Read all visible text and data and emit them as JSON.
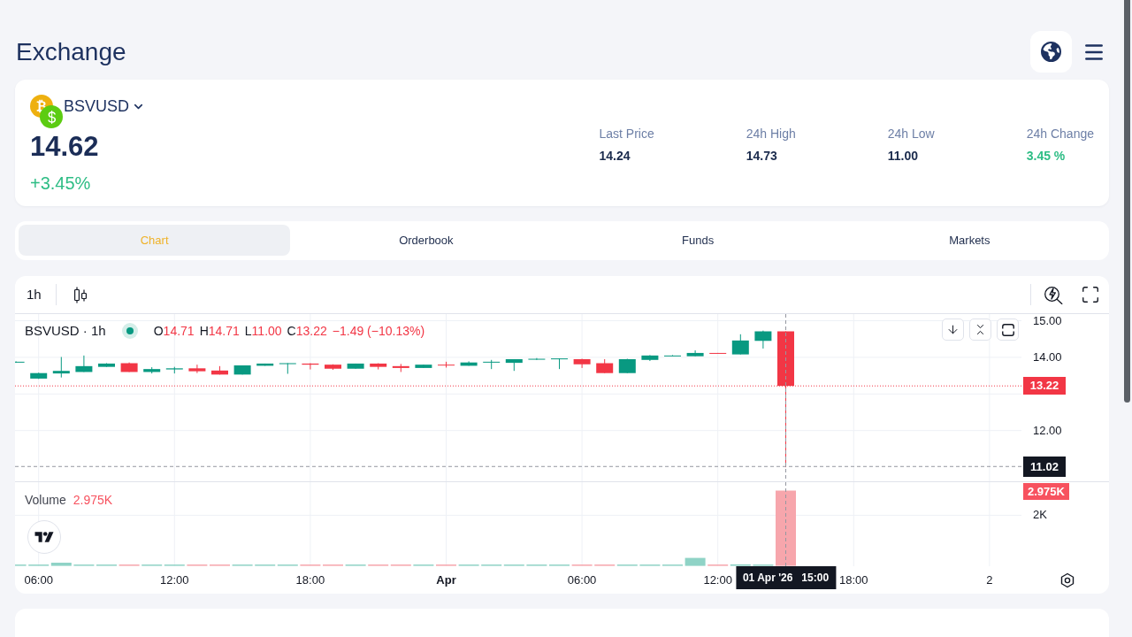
{
  "header": {
    "title": "Exchange"
  },
  "ticker": {
    "symbol": "BSVUSD",
    "price": "14.62",
    "change": "+3.45%",
    "rising": true,
    "stats": [
      {
        "label": "Last Price",
        "value": "14.24",
        "kind": "plain"
      },
      {
        "label": "24h High",
        "value": "14.73",
        "kind": "plain"
      },
      {
        "label": "24h Low",
        "value": "11.00",
        "kind": "plain"
      },
      {
        "label": "24h Change",
        "value": "3.45 %",
        "kind": "change"
      }
    ]
  },
  "tabs": [
    {
      "label": "Chart",
      "selected": true
    },
    {
      "label": "Orderbook",
      "selected": false
    },
    {
      "label": "Funds",
      "selected": false
    },
    {
      "label": "Markets",
      "selected": false
    }
  ],
  "chart": {
    "interval": "1h",
    "legend": {
      "title": "BSVUSD · 1h",
      "rising": false,
      "readings": [
        {
          "key": "O",
          "value": "14.71"
        },
        {
          "key": "H",
          "value": "14.71"
        },
        {
          "key": "L",
          "value": "11.00"
        },
        {
          "key": "C",
          "value": "13.22"
        }
      ],
      "change": "−1.49 (−10.13%)"
    },
    "price_axis": {
      "ticks": [
        "15.00",
        "14.00",
        "12.00"
      ],
      "last_price": "13.22",
      "crosshair_price": "11.02"
    },
    "volume": {
      "label": "Volume",
      "value": "2.975K",
      "rising": false,
      "axis_value": "2.975K",
      "ticks": [
        "2K"
      ]
    },
    "time_axis": {
      "labels": [
        {
          "text": "06:00",
          "bold": false
        },
        {
          "text": "12:00",
          "bold": false
        },
        {
          "text": "18:00",
          "bold": false
        },
        {
          "text": "Apr",
          "bold": true
        },
        {
          "text": "06:00",
          "bold": false
        },
        {
          "text": "12:00",
          "bold": false
        },
        {
          "text": "18:00",
          "bold": false
        },
        {
          "text": "2",
          "bold": false
        }
      ],
      "crosshair_time": "01 Apr '26   15:00"
    }
  }
}
